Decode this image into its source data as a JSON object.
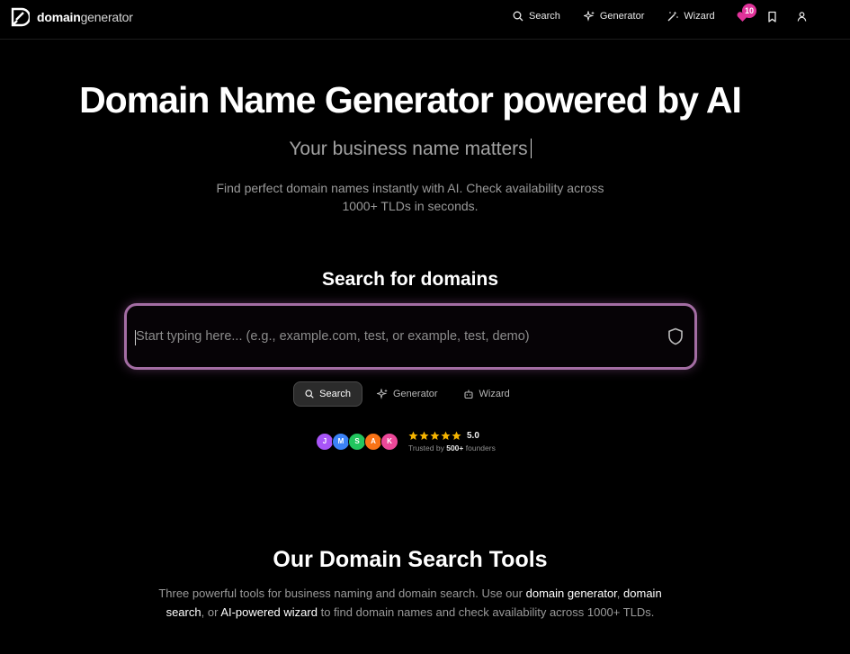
{
  "logo": {
    "bold": "domain",
    "light": "generator"
  },
  "nav": {
    "links": [
      {
        "label": "Search",
        "icon": "search-icon"
      },
      {
        "label": "Generator",
        "icon": "sparkles-icon"
      },
      {
        "label": "Wizard",
        "icon": "magic-wand-icon"
      }
    ],
    "favorites_count": "10"
  },
  "hero": {
    "title": "Domain Name Generator powered by AI",
    "subtitle": "Your business name matters",
    "description": "Find perfect domain names instantly with AI. Check availability across 1000+ TLDs in seconds."
  },
  "search": {
    "heading": "Search for domains",
    "placeholder": "Start typing here... (e.g., example.com, test, or example, test, demo)",
    "value": "",
    "modes": [
      {
        "label": "Search",
        "icon": "search-icon",
        "active": true
      },
      {
        "label": "Generator",
        "icon": "sparkles-icon",
        "active": false
      },
      {
        "label": "Wizard",
        "icon": "robot-icon",
        "active": false
      }
    ]
  },
  "social_proof": {
    "avatars": [
      {
        "initial": "J",
        "color": "#a855f7"
      },
      {
        "initial": "M",
        "color": "#3b82f6"
      },
      {
        "initial": "S",
        "color": "#22c55e"
      },
      {
        "initial": "A",
        "color": "#f97316"
      },
      {
        "initial": "K",
        "color": "#ec4899"
      }
    ],
    "stars": 5,
    "rating": "5.0",
    "trusted_prefix": "Trusted by",
    "trusted_count": "500+",
    "trusted_suffix": "founders"
  },
  "tools": {
    "title": "Our Domain Search Tools",
    "desc_part1": "Three powerful tools for business naming and domain search. Use our",
    "link1": "domain generator",
    "link2": "domain search",
    "desc_part2": ", or",
    "link3": "AI-powered wizard",
    "desc_part3": "to find domain names and check availability across 1000+ TLDs."
  },
  "colors": {
    "accent_border": "#a36da3",
    "badge": "#e0339a",
    "star": "#f5b400"
  }
}
